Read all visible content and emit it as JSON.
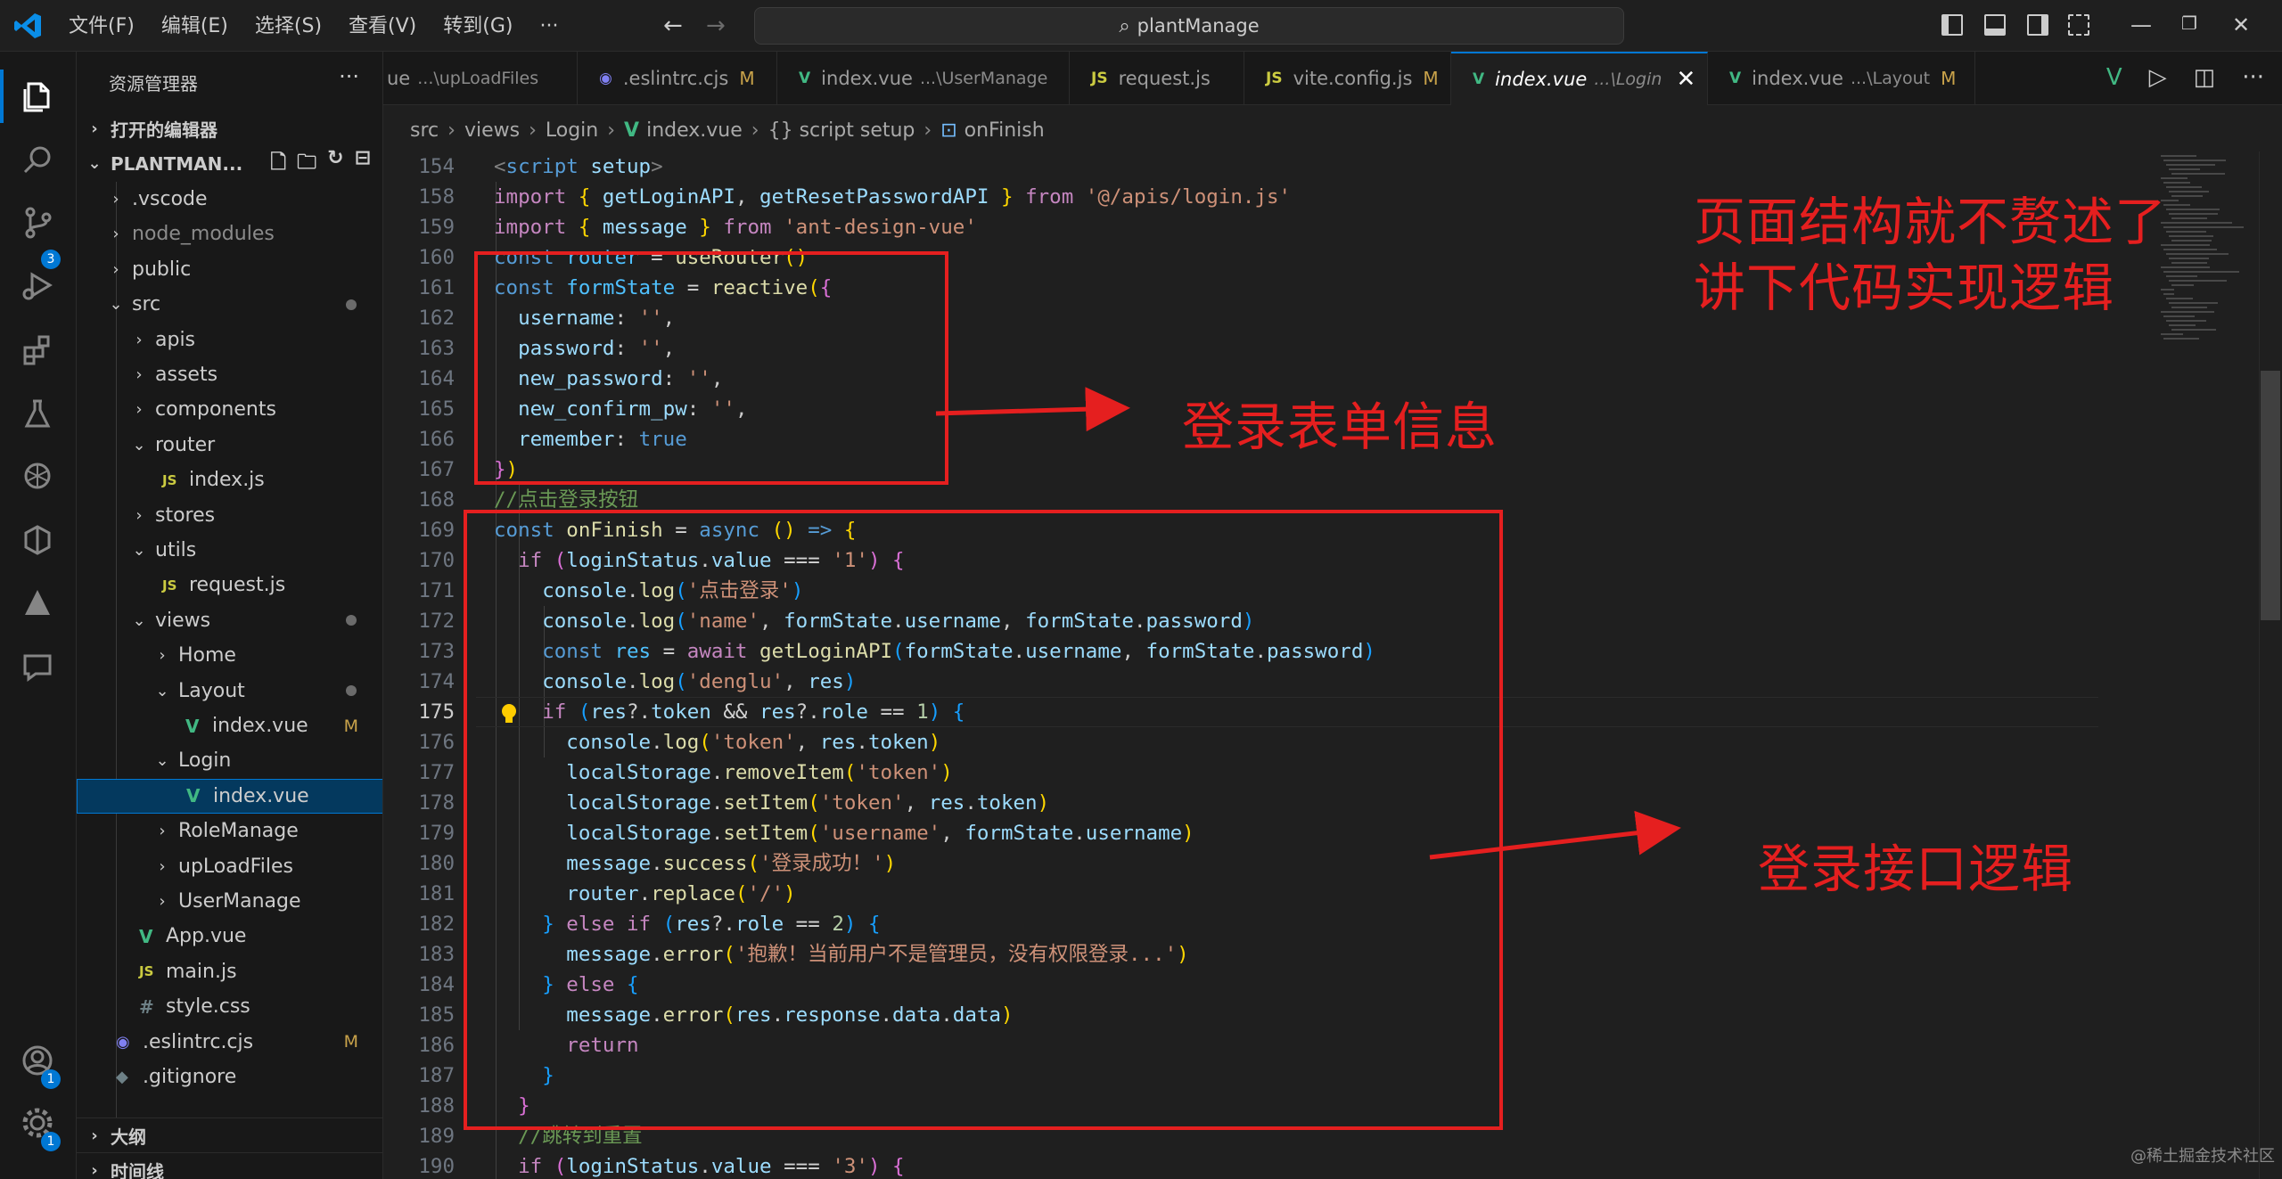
{
  "titlebar": {
    "menu": [
      "文件(F)",
      "编辑(E)",
      "选择(S)",
      "查看(V)",
      "转到(G)",
      "···"
    ],
    "search_text": "plantManage"
  },
  "activity": {
    "scm_badge": "3",
    "account_badge": "1",
    "settings_badge": "1"
  },
  "sidebar": {
    "title": "资源管理器",
    "open_editors": "打开的编辑器",
    "project": "PLANTMAN...",
    "outline": "大纲",
    "timeline": "时间线",
    "items": [
      {
        "label": ".vscode",
        "type": "folder"
      },
      {
        "label": "node_modules",
        "type": "folder"
      },
      {
        "label": "public",
        "type": "folder"
      },
      {
        "label": "src",
        "type": "folder-open"
      },
      {
        "label": "apis",
        "type": "folder"
      },
      {
        "label": "assets",
        "type": "folder"
      },
      {
        "label": "components",
        "type": "folder"
      },
      {
        "label": "router",
        "type": "folder-open"
      },
      {
        "label": "index.js",
        "type": "js"
      },
      {
        "label": "stores",
        "type": "folder"
      },
      {
        "label": "utils",
        "type": "folder-open"
      },
      {
        "label": "request.js",
        "type": "js"
      },
      {
        "label": "views",
        "type": "folder-open"
      },
      {
        "label": "Home",
        "type": "folder"
      },
      {
        "label": "Layout",
        "type": "folder-open"
      },
      {
        "label": "index.vue",
        "type": "vue",
        "mod": "M"
      },
      {
        "label": "Login",
        "type": "folder-open"
      },
      {
        "label": "index.vue",
        "type": "vue"
      },
      {
        "label": "RoleManage",
        "type": "folder"
      },
      {
        "label": "upLoadFiles",
        "type": "folder"
      },
      {
        "label": "UserManage",
        "type": "folder"
      },
      {
        "label": "App.vue",
        "type": "vue"
      },
      {
        "label": "main.js",
        "type": "js"
      },
      {
        "label": "style.css",
        "type": "css"
      },
      {
        "label": ".eslintrc.cjs",
        "type": "eslint",
        "mod": "M"
      },
      {
        "label": ".gitignore",
        "type": "git"
      }
    ]
  },
  "tabs": [
    {
      "name": "ue",
      "sub": "...\\upLoadFiles",
      "icon": "vue"
    },
    {
      "name": ".eslintrc.cjs",
      "sub": "",
      "mod": "M",
      "icon": "eslint"
    },
    {
      "name": "index.vue",
      "sub": "...\\UserManage",
      "icon": "vue"
    },
    {
      "name": "request.js",
      "sub": "",
      "icon": "js"
    },
    {
      "name": "vite.config.js",
      "sub": "",
      "mod": "M",
      "icon": "js"
    },
    {
      "name": "index.vue",
      "sub": "...\\Login",
      "icon": "vue",
      "active": true
    },
    {
      "name": "index.vue",
      "sub": "...\\Layout",
      "mod": "M",
      "icon": "vue"
    }
  ],
  "breadcrumb": [
    "src",
    "views",
    "Login",
    "index.vue",
    "{} script setup",
    "onFinish"
  ],
  "code": {
    "line_numbers": [
      "154",
      "158",
      "159",
      "160",
      "161",
      "162",
      "163",
      "164",
      "165",
      "166",
      "167",
      "168",
      "169",
      "170",
      "171",
      "172",
      "173",
      "174",
      "175",
      "176",
      "177",
      "178",
      "179",
      "180",
      "181",
      "182",
      "183",
      "184",
      "185",
      "186",
      "187",
      "188",
      "189",
      "190"
    ],
    "current_line": "175"
  },
  "annotations": {
    "top_note_1": "页面结构就不赘述了",
    "top_note_2": "讲下代码实现逻辑",
    "form_note": "登录表单信息",
    "api_note": "登录接口逻辑"
  },
  "watermark": "@稀土掘金技术社区"
}
